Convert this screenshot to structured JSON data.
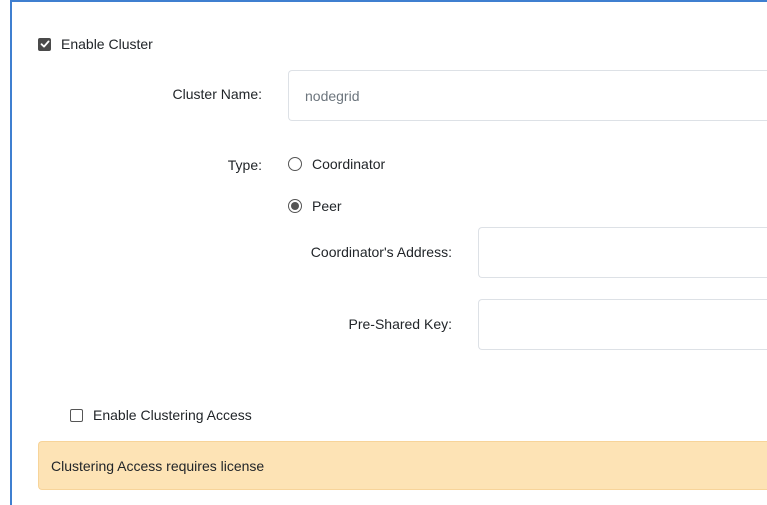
{
  "cluster": {
    "enable_label": "Enable Cluster",
    "enable_checked": true,
    "name_label": "Cluster Name:",
    "name_value": "nodegrid",
    "type_label": "Type:",
    "type_options": [
      {
        "label": "Coordinator",
        "selected": false
      },
      {
        "label": "Peer",
        "selected": true
      }
    ],
    "coordinator_address_label": "Coordinator's Address:",
    "coordinator_address_value": "",
    "pre_shared_key_label": "Pre-Shared Key:",
    "pre_shared_key_value": ""
  },
  "clustering_access": {
    "enable_label": "Enable Clustering Access",
    "enable_checked": false,
    "license_message": "Clustering Access requires license"
  },
  "colors": {
    "accent_border": "#3f7fd0",
    "alert_background": "#fde3b5"
  }
}
